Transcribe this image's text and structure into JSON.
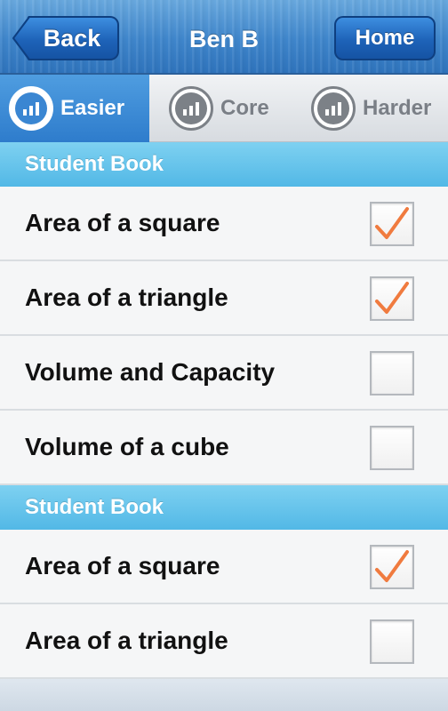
{
  "header": {
    "back_label": "Back",
    "title": "Ben B",
    "home_label": "Home"
  },
  "tabs": [
    {
      "label": "Easier",
      "active": true,
      "icon": "bar-chart-icon"
    },
    {
      "label": "Core",
      "active": false,
      "icon": "bar-chart-icon"
    },
    {
      "label": "Harder",
      "active": false,
      "icon": "bar-chart-icon"
    }
  ],
  "sections": [
    {
      "title": "Student Book",
      "items": [
        {
          "label": "Area of a square",
          "checked": true
        },
        {
          "label": "Area of a triangle",
          "checked": true
        },
        {
          "label": "Volume and Capacity",
          "checked": false
        },
        {
          "label": "Volume of a cube",
          "checked": false
        }
      ]
    },
    {
      "title": "Student Book",
      "items": [
        {
          "label": "Area of a square",
          "checked": true
        },
        {
          "label": "Area of a triangle",
          "checked": false
        }
      ]
    }
  ],
  "colors": {
    "accent": "#2e7ccc",
    "section": "#52b8e6",
    "check": "#f07b3f"
  }
}
